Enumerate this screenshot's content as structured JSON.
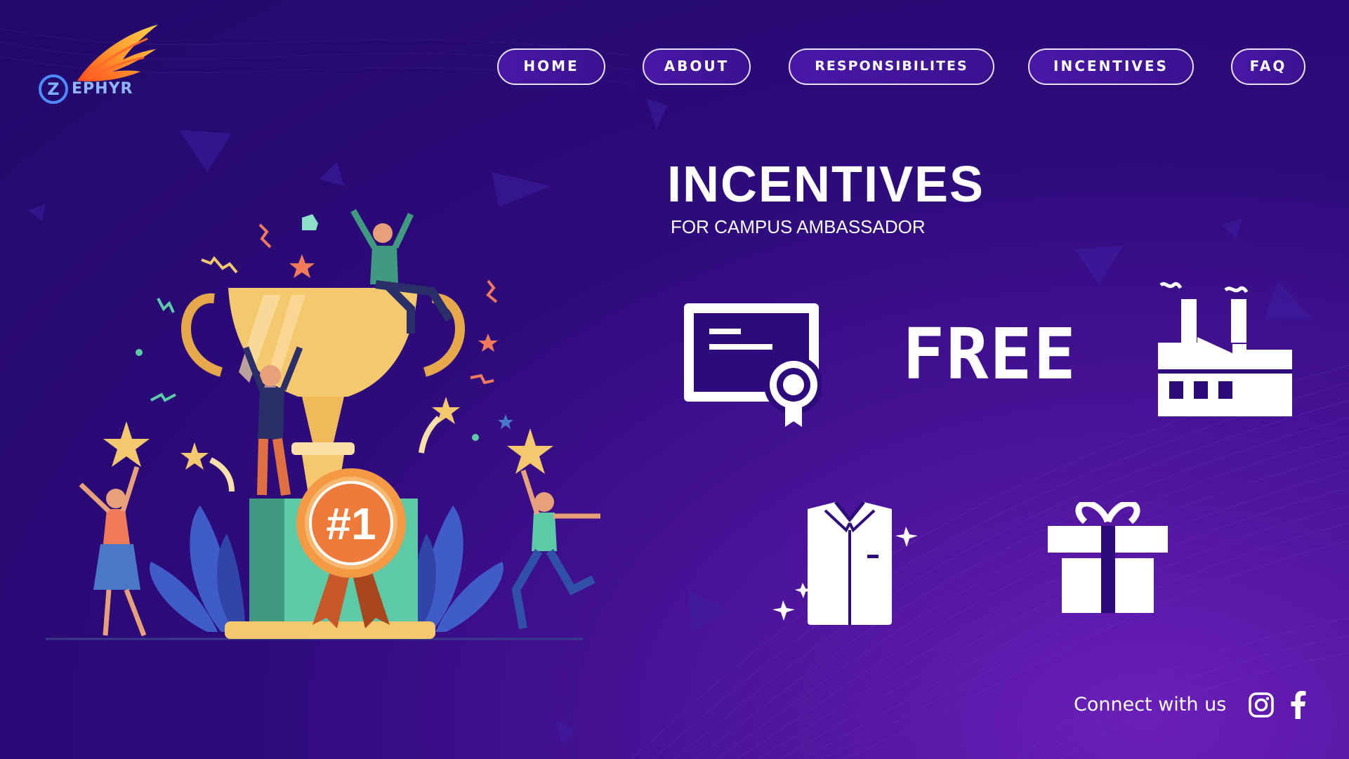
{
  "brand": {
    "logo_letter": "Z",
    "logo_text": "EPHYR"
  },
  "nav": {
    "home": "HOME",
    "about": "ABOUT",
    "responsibilities": "RESPONSIBILITES",
    "incentives": "INCENTIVES",
    "faq": "FAQ"
  },
  "hero": {
    "title": "INCENTIVES",
    "subtitle": "FOR CAMPUS AMBASSADOR"
  },
  "incentives": {
    "icons": [
      "certificate-icon",
      "free-icon",
      "factory-icon",
      "shirt-icon",
      "gift-icon"
    ],
    "free_label": "FREE"
  },
  "illustration": {
    "medal_text": "#1"
  },
  "footer": {
    "connect_text": "Connect with us",
    "socials": [
      "instagram-icon",
      "facebook-icon"
    ]
  },
  "colors": {
    "background": "#2e0b7c",
    "accent": "#6a1fb8",
    "nav_border": "#e9e2ff",
    "trophy": "#f5c86e",
    "logo_blue": "#4c8cff",
    "logo_orange": "#ff9a2e"
  }
}
